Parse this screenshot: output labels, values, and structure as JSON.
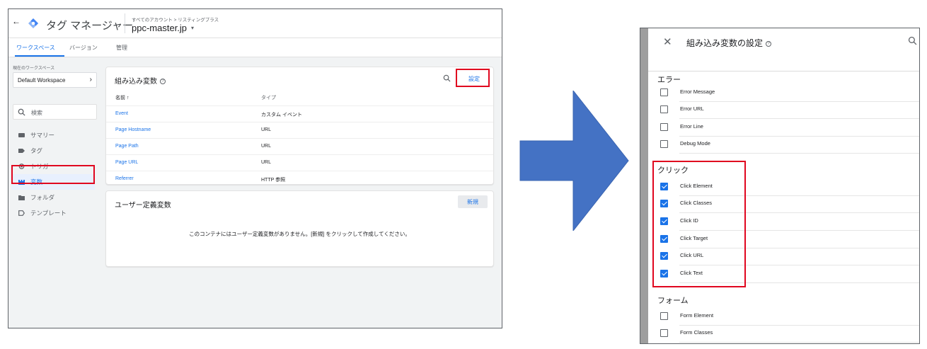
{
  "colors": {
    "accent": "#1a73e8",
    "highlight": "#e0061f",
    "arrow": "#4472c4"
  },
  "left": {
    "header": {
      "back_icon": "back-arrow-icon",
      "logo_icon": "gtm-diamond-logo-icon",
      "app_name": "タグ マネージャー",
      "account_path": "すべてのアカウント > リスティングプラス",
      "container_name": "ppc-master.jp",
      "container_caret": "▾"
    },
    "tabs": [
      {
        "label": "ワークスペース",
        "active": true
      },
      {
        "label": "バージョン",
        "active": false
      },
      {
        "label": "管理",
        "active": false
      }
    ],
    "sidebar": {
      "current_ws_label": "現在のワークスペース",
      "workspace_name": "Default Workspace",
      "workspace_arrow": "›",
      "search_placeholder": "検索",
      "items": [
        {
          "label": "サマリー",
          "icon": "summary-icon"
        },
        {
          "label": "タグ",
          "icon": "tag-icon"
        },
        {
          "label": "トリガー",
          "icon": "trigger-icon"
        },
        {
          "label": "変数",
          "icon": "variables-icon",
          "active": true
        },
        {
          "label": "フォルダ",
          "icon": "folder-icon"
        },
        {
          "label": "テンプレート",
          "icon": "template-icon"
        }
      ]
    },
    "builtin": {
      "title": "組み込み変数",
      "help": "?",
      "configure_label": "設定",
      "col_name": "名前 ↑",
      "col_type": "タイプ",
      "rows": [
        {
          "name": "Event",
          "type": "カスタム イベント"
        },
        {
          "name": "Page Hostname",
          "type": "URL"
        },
        {
          "name": "Page Path",
          "type": "URL"
        },
        {
          "name": "Page URL",
          "type": "URL"
        },
        {
          "name": "Referrer",
          "type": "HTTP 参照"
        }
      ]
    },
    "user_defined": {
      "title": "ユーザー定義変数",
      "new_label": "新規",
      "empty_message": "このコンテナにはユーザー定義変数がありません。[新規] をクリックして作成してください。"
    }
  },
  "right": {
    "close_icon": "✕",
    "title": "組み込み変数の設定",
    "help": "?",
    "sections": {
      "errors": {
        "title": "エラー",
        "items": [
          {
            "label": "Error Message",
            "checked": false
          },
          {
            "label": "Error URL",
            "checked": false
          },
          {
            "label": "Error Line",
            "checked": false
          },
          {
            "label": "Debug Mode",
            "checked": false
          }
        ]
      },
      "clicks": {
        "title": "クリック",
        "items": [
          {
            "label": "Click Element",
            "checked": true
          },
          {
            "label": "Click Classes",
            "checked": true
          },
          {
            "label": "Click ID",
            "checked": true
          },
          {
            "label": "Click Target",
            "checked": true
          },
          {
            "label": "Click URL",
            "checked": true
          },
          {
            "label": "Click Text",
            "checked": true
          }
        ]
      },
      "forms": {
        "title": "フォーム",
        "items": [
          {
            "label": "Form Element",
            "checked": false
          },
          {
            "label": "Form Classes",
            "checked": false
          }
        ]
      }
    }
  }
}
